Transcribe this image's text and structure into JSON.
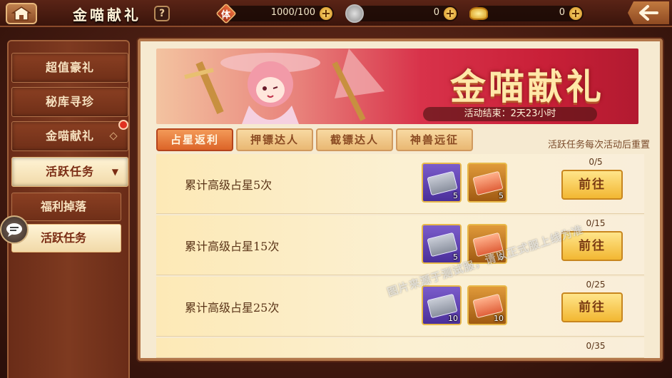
{
  "header": {
    "title": "金喵献礼",
    "help": "?",
    "stamina": {
      "icon": "体",
      "value": "1000/100"
    },
    "coins": {
      "value": "0"
    },
    "gold": {
      "value": "0"
    },
    "plus": "+"
  },
  "sidebar": {
    "items": [
      {
        "label": "超值豪礼"
      },
      {
        "label": "秘库寻珍"
      },
      {
        "label": "金喵献礼"
      },
      {
        "label": "活跃任务"
      }
    ],
    "sub_items": [
      {
        "label": "福利掉落"
      },
      {
        "label": "活跃任务"
      }
    ]
  },
  "banner": {
    "title": "金喵献礼",
    "timer": "活动结束：2天23小时"
  },
  "tabs": [
    {
      "label": "占星返利"
    },
    {
      "label": "押镖达人"
    },
    {
      "label": "截镖达人"
    },
    {
      "label": "神兽远征"
    }
  ],
  "notice": "活跃任务每次活动后重置",
  "tasks": [
    {
      "name": "累计高级占星5次",
      "progress": "0/5",
      "rewards": [
        "5",
        "5"
      ],
      "button": "前往"
    },
    {
      "name": "累计高级占星15次",
      "progress": "0/15",
      "rewards": [
        "5",
        "5"
      ],
      "button": "前往"
    },
    {
      "name": "累计高级占星25次",
      "progress": "0/25",
      "rewards": [
        "10",
        "10"
      ],
      "button": "前往"
    },
    {
      "progress": "0/35"
    }
  ],
  "watermark": "图片来源于测试服，请以正式服上线为准",
  "colors": {
    "accent_orange": "#dc6428",
    "button_gold": "#f2b732",
    "banner_red": "#c92038",
    "panel_bg": "#f6ead1"
  }
}
